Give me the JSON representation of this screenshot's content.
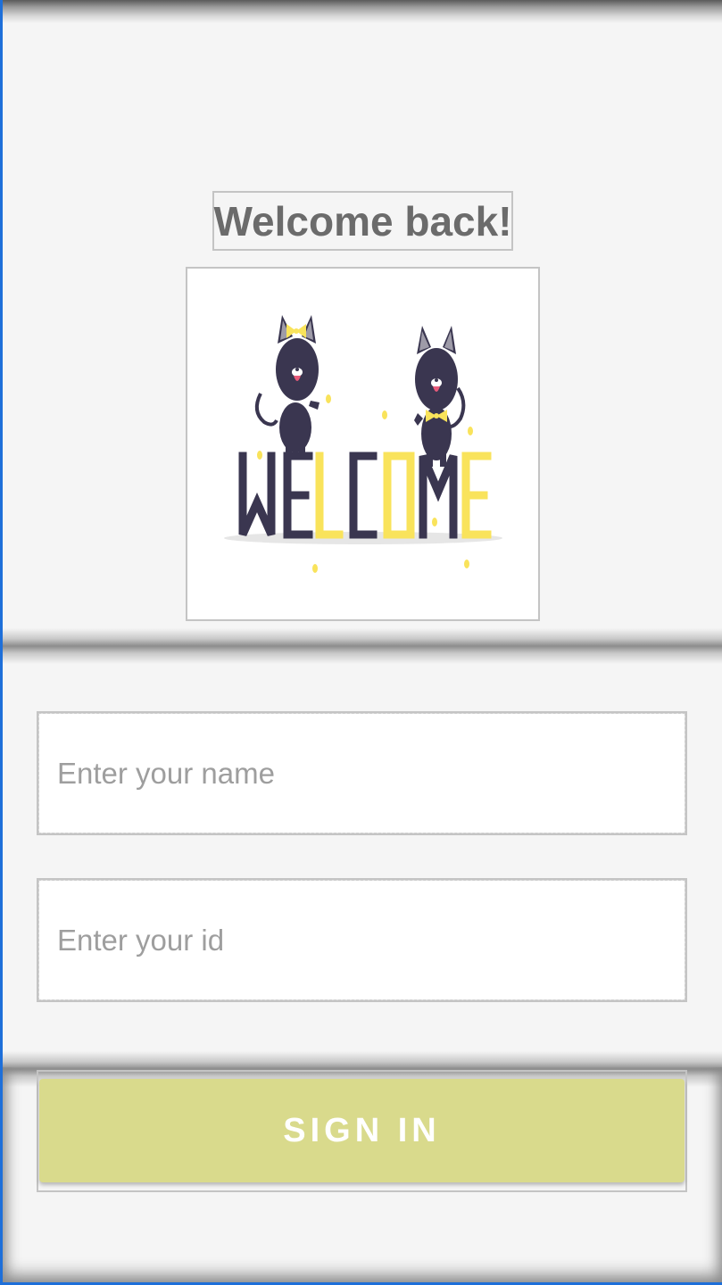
{
  "header": {
    "title": "Welcome back!"
  },
  "illustration": {
    "text": "WELCOME",
    "colors": {
      "dark": "#3a3650",
      "accent": "#f9e35b",
      "shadow": "#e6e6e6"
    }
  },
  "form": {
    "name_placeholder": "Enter your name",
    "id_placeholder": "Enter your id",
    "submit_label": "SIGN IN"
  },
  "colors": {
    "background": "#f5f5f5",
    "button": "#d9da8c",
    "title": "#6b6b6b",
    "placeholder": "#9e9e9e"
  }
}
